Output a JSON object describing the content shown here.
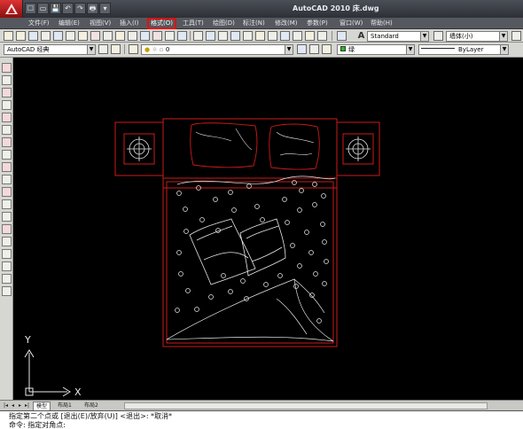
{
  "window": {
    "title": "AutoCAD 2010    床.dwg"
  },
  "quick_access": {
    "items": [
      "☐",
      "▭",
      "💾",
      "↶",
      "↷",
      "🖶",
      "▾"
    ]
  },
  "menubar": {
    "items": [
      "文件(F)",
      "编辑(E)",
      "视图(V)",
      "插入(I)",
      "格式(O)",
      "工具(T)",
      "绘图(D)",
      "标注(N)",
      "修改(M)",
      "参数(P)",
      "窗口(W)",
      "帮助(H)"
    ],
    "highlighted": "格式(O)"
  },
  "toolbar1": {
    "text_style": "Standard",
    "dim_style": "墙体(小)"
  },
  "toolbar2": {
    "workspace": "AutoCAD 经典",
    "layer": "0",
    "color": "绿",
    "linetype": "ByLayer"
  },
  "ucs": {
    "x_label": "X",
    "y_label": "Y"
  },
  "tabs": {
    "items": [
      "模型",
      "布局1",
      "布局2"
    ],
    "active": "模型"
  },
  "command": {
    "line1": "指定第二个点或 [退出(E)/放弃(U)] <退出>:  *取消*",
    "line2": "命令: 指定对角点:"
  },
  "colors": {
    "drawing_background": "#000000",
    "furniture_line": "#cc1a1a",
    "sketch_line": "#e8e8e8",
    "highlight": "#e01010"
  }
}
